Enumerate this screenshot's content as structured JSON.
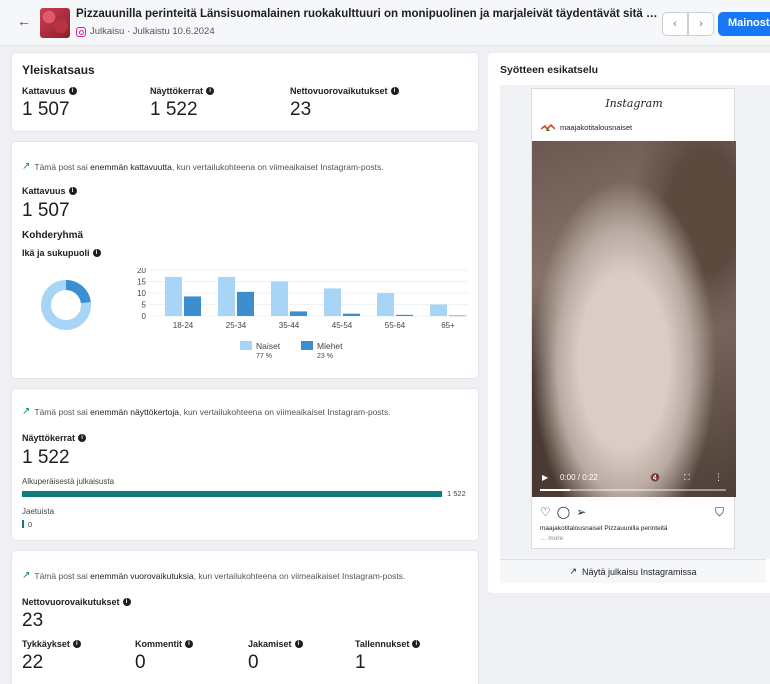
{
  "header": {
    "back_label": "←",
    "title": "Pizzauunilla perinteitä Länsisuomalainen ruokakulttuuri on monipuolinen ja marjaleivät täydentävät sitä erilaisin variaat…",
    "subtitle": "Julkaisu · Julkaistu 10.6.2024",
    "prev_label": "‹",
    "next_label": "›",
    "boost_label": "Mainosta"
  },
  "overview": {
    "title": "Yleiskatsaus",
    "metrics": [
      {
        "label": "Kattavuus",
        "value": "1 507"
      },
      {
        "label": "Näyttökerrat",
        "value": "1 522"
      },
      {
        "label": "Nettovuorovaikutukset",
        "value": "23"
      }
    ]
  },
  "reach": {
    "trend_prefix": "Tämä post sai ",
    "trend_bold": "enemmän kattavuutta",
    "trend_suffix": ", kun vertailukohteena on viimeaikaiset Instagram-posts.",
    "label": "Kattavuus",
    "value": "1 507",
    "audience_title": "Kohderyhmä",
    "age_label": "Ikä ja sukupuoli"
  },
  "chart_data": {
    "type": "bar",
    "categories": [
      "18-24",
      "25-34",
      "35-44",
      "45-54",
      "55-64",
      "65+"
    ],
    "series": [
      {
        "name": "Naiset",
        "values": [
          17,
          17,
          15,
          12,
          10,
          5
        ],
        "color": "#a8d4f5"
      },
      {
        "name": "Miehet",
        "values": [
          8.5,
          10.5,
          2,
          1,
          0.5,
          0.2
        ],
        "color": "#3b8ed0"
      }
    ],
    "yticks": [
      "0",
      "5",
      "10",
      "15",
      "20"
    ],
    "ylim": [
      0,
      20
    ],
    "legend": [
      {
        "name": "Naiset",
        "pct": "77 %"
      },
      {
        "name": "Miehet",
        "pct": "23 %"
      }
    ],
    "donut": {
      "naiset_pct": 77,
      "miehet_pct": 23
    }
  },
  "impressions": {
    "trend_prefix": "Tämä post sai ",
    "trend_bold": "enemmän näyttökertoja",
    "trend_suffix": ", kun vertailukohteena on viimeaikaiset Instagram-posts.",
    "label": "Näyttökerrat",
    "value": "1 522",
    "origin_label": "Alkuperäisestä julkaisusta",
    "origin_value": "1 522",
    "origin_fraction": 1.0,
    "shared_label": "Jaetuista",
    "shared_value": "0"
  },
  "engagement": {
    "trend_prefix": "Tämä post sai ",
    "trend_bold": "enemmän vuorovaikutuksia",
    "trend_suffix": ", kun vertailukohteena on viimeaikaiset Instagram-posts.",
    "label": "Nettovuorovaikutukset",
    "value": "23",
    "metrics": [
      {
        "label": "Tykkäykset",
        "value": "22"
      },
      {
        "label": "Kommentit",
        "value": "0"
      },
      {
        "label": "Jakamiset",
        "value": "0"
      },
      {
        "label": "Tallennukset",
        "value": "1"
      }
    ]
  },
  "preview": {
    "title": "Syötteen esikatselu",
    "ig_logo": "Instagram",
    "username": "maajakotitalousnaiset",
    "video_time": "0:00 / 0:22",
    "caption": "maajakotitalousnaiset Pizzauunilla perinteitä",
    "more": "… more",
    "view_button": "Näytä julkaisu Instagramissa"
  }
}
